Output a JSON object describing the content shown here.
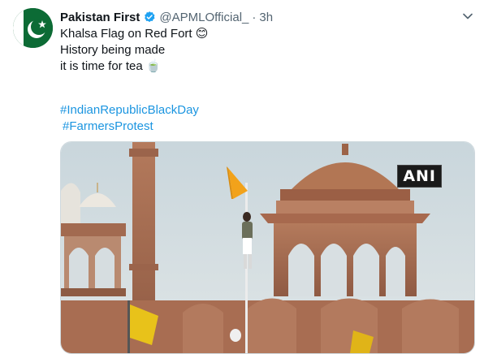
{
  "tweet": {
    "author_name": "Pakistan First",
    "handle": "@APMLOfficial_",
    "separator": "·",
    "time": "3h",
    "lines": [
      "Khalsa Flag on Red Fort 😊",
      "History being made",
      "it is time for tea 🍵"
    ],
    "hashtags": [
      "#IndianRepublicBlackDay",
      "#FarmersProtest"
    ],
    "media": {
      "watermark": "ANI"
    }
  },
  "icons": {
    "avatar": "pakistan-flag-avatar",
    "verified": "verified-badge-icon",
    "more": "more-options-icon"
  },
  "colors": {
    "link": "#1b95e0",
    "verified": "#1da1f2",
    "secondary_text": "#536471"
  }
}
